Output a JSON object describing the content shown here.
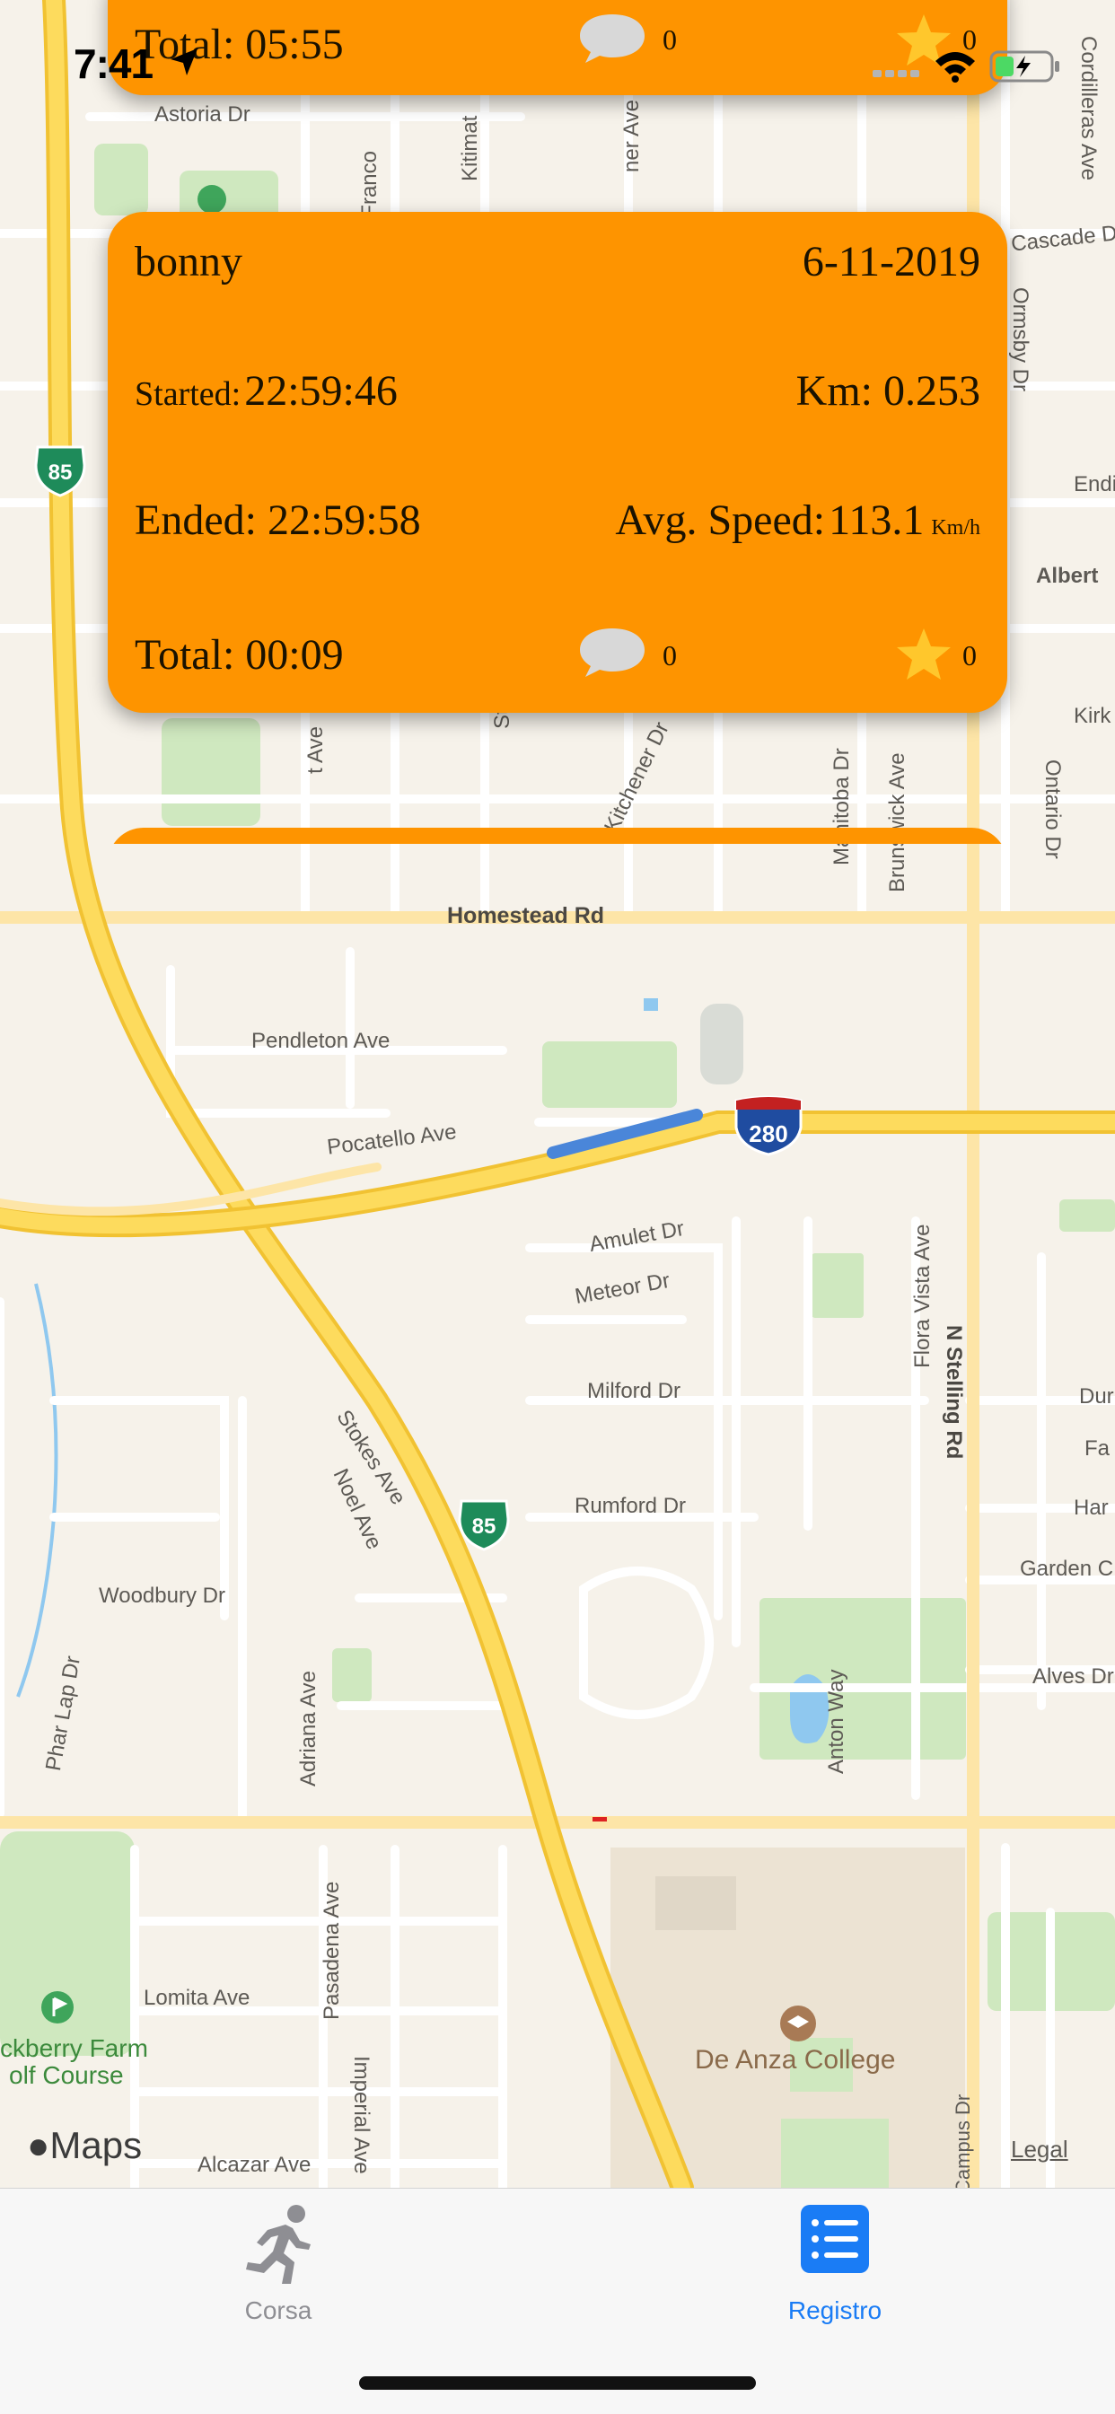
{
  "status_bar": {
    "time": "7:41"
  },
  "cards": [
    {
      "total_label": "Total:",
      "total": "05:55",
      "comments": "0",
      "stars": "0"
    },
    {
      "user": "bonny",
      "date": "6-11-2019",
      "started_label": "Started:",
      "started": "22:59:46",
      "km_label": "Km:",
      "km": "0.253",
      "ended_label": "Ended:",
      "ended": "22:59:58",
      "speed_label": "Avg. Speed:",
      "speed": "113.1",
      "speed_unit": "Km/h",
      "total_label": "Total:",
      "total": "00:09",
      "comments": "0",
      "stars": "0"
    }
  ],
  "map": {
    "streets": {
      "astoria": "Astoria Dr",
      "franco": "Franco",
      "kitimat": "Kitimat",
      "ner": "ner Ave",
      "cordilleras": "Cordilleras Ave",
      "cascade": "Cascade Dr",
      "ormsby": "Ormsby Dr",
      "endi": "Endi",
      "albert": "Albert",
      "kirk": "Kirk",
      "ontario": "Ontario Dr",
      "kitchener": "Kitchener Dr",
      "manitoba": "Manitoba Dr",
      "brunswick": "Brunswick Ave",
      "t_ave": "t Ave",
      "st": "St",
      "homestead": "Homestead Rd",
      "pendleton": "Pendleton Ave",
      "pocatello": "Pocatello Ave",
      "amulet": "Amulet Dr",
      "meteor": "Meteor Dr",
      "flora_vista": "Flora Vista Ave",
      "stelling": "N Stelling Rd",
      "milford": "Milford Dr",
      "stokes": "Stokes Ave",
      "noel": "Noel Ave",
      "rumford": "Rumford Dr",
      "dur": "Dur",
      "fa": "Fa",
      "har": "Har",
      "garden": "Garden C",
      "woodbury": "Woodbury Dr",
      "phar_lap": "Phar Lap Dr",
      "adriana": "Adriana Ave",
      "anton": "Anton Way",
      "alves": "Alves Dr",
      "pasadena": "Pasadena Ave",
      "imperial": "Imperial Ave",
      "lomita": "Lomita Ave",
      "alcazar": "Alcazar Ave",
      "campus": "Campus Dr"
    },
    "pois": {
      "de_anza": "De Anza College",
      "golf_1": "ckberry Farm",
      "golf_2": "olf Course"
    },
    "shields": {
      "sr85": "85",
      "i280": "280"
    },
    "maps_logo": "Maps",
    "legal": "Legal"
  },
  "tabbar": {
    "tabs": [
      {
        "label": "Corsa",
        "icon": "runner-icon"
      },
      {
        "label": "Registro",
        "icon": "list-icon"
      }
    ],
    "active_color": "#1a7cf5",
    "inactive_color": "#8e8e93"
  },
  "colors": {
    "card": "#fe9400",
    "freeway": "#fcd34d",
    "route": "#4a86d9"
  }
}
